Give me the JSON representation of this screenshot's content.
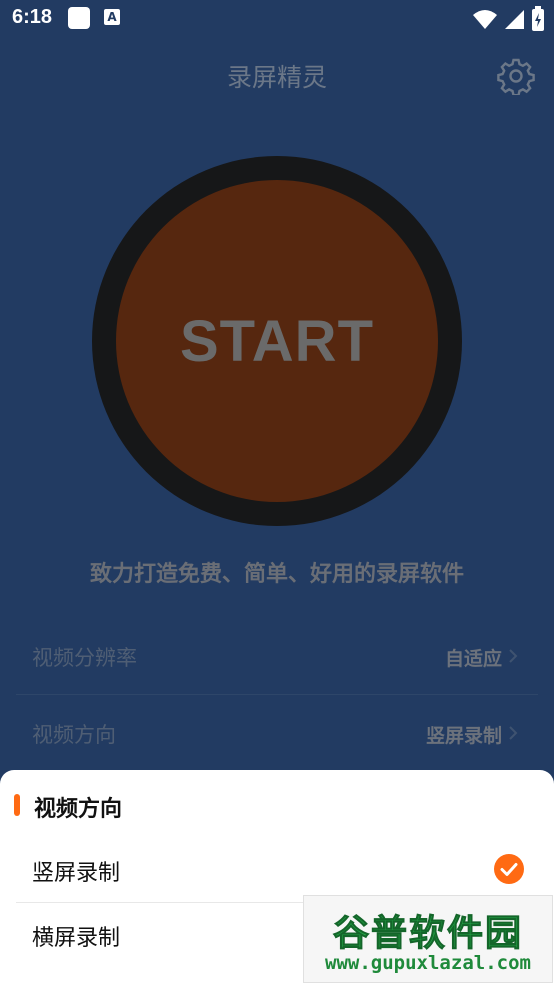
{
  "status_bar": {
    "time": "6:18",
    "notification_icons": [
      "square-icon",
      "a-icon"
    ],
    "a_glyph": "A",
    "right_icons": [
      "wifi-icon",
      "signal-icon",
      "battery-icon"
    ]
  },
  "header": {
    "title": "录屏精灵",
    "settings_icon": "gear-icon"
  },
  "start_button": {
    "label": "START",
    "inner_color": "#56270f",
    "ring_color": "#161718"
  },
  "slogan": "致力打造免费、简单、好用的录屏软件",
  "settings": [
    {
      "label": "视频分辨率",
      "value": "自适应"
    },
    {
      "label": "视频方向",
      "value": "竖屏录制"
    }
  ],
  "sheet": {
    "title": "视频方向",
    "options": [
      {
        "label": "竖屏录制",
        "selected": true
      },
      {
        "label": "横屏录制",
        "selected": false
      }
    ],
    "accent_color": "#ff6a13"
  },
  "watermark": {
    "logo": "谷普软件园",
    "url": "www.gupuxlazal.com"
  },
  "colors": {
    "background": "#223b62",
    "accent": "#ff6a13"
  }
}
